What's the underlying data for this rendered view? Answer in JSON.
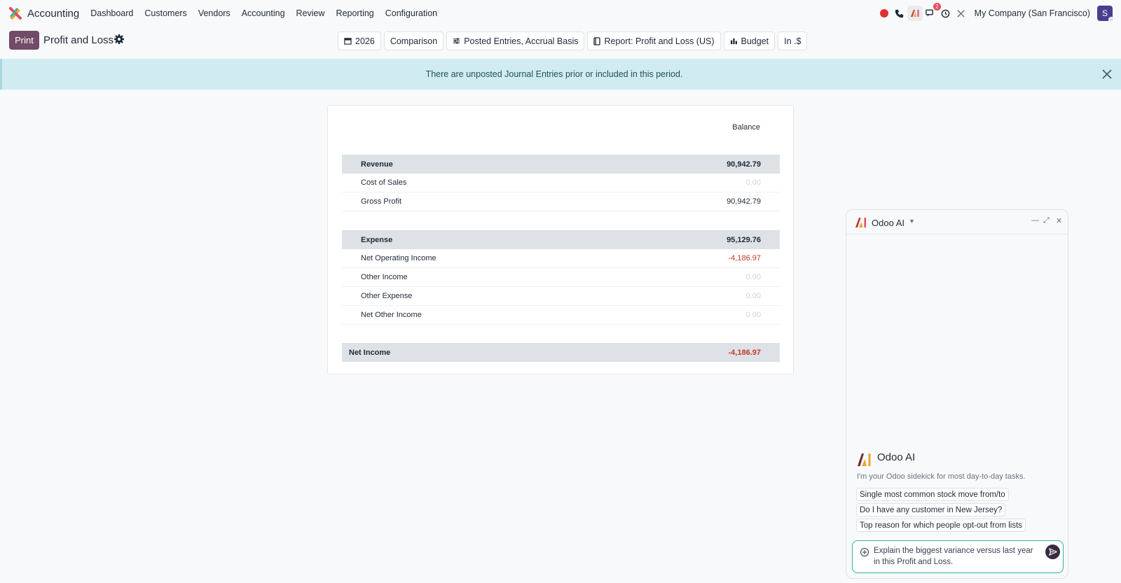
{
  "navbar": {
    "app_name": "Accounting",
    "menu": [
      "Dashboard",
      "Customers",
      "Vendors",
      "Accounting",
      "Review",
      "Reporting",
      "Configuration"
    ],
    "message_badge": "2",
    "company": "My Company (San Francisco)",
    "avatar_initial": "S"
  },
  "control_panel": {
    "print_label": "Print",
    "title": "Profit and Loss",
    "filters": {
      "period": "2026",
      "comparison": "Comparison",
      "entries": "Posted Entries, Accrual Basis",
      "report": "Report: Profit and Loss (US)",
      "budget": "Budget",
      "currency": "In .$"
    }
  },
  "alert": {
    "message": "There are unposted Journal Entries prior or included in this period."
  },
  "report": {
    "column_header": "Balance",
    "rows": [
      {
        "label": "Revenue",
        "value": "90,942.79"
      },
      {
        "label": "Cost of Sales",
        "value": "0.00"
      },
      {
        "label": "Gross Profit",
        "value": "90,942.79"
      },
      {
        "label": "Expense",
        "value": "95,129.76"
      },
      {
        "label": "Net Operating Income",
        "value": "-4,186.97"
      },
      {
        "label": "Other Income",
        "value": "0.00"
      },
      {
        "label": "Other Expense",
        "value": "0.00"
      },
      {
        "label": "Net Other Income",
        "value": "0.00"
      },
      {
        "label": "Net Income",
        "value": "-4,186.97"
      }
    ]
  },
  "ai_panel": {
    "title": "Odoo AI",
    "intro_title": "Odoo AI",
    "intro_subtitle": "I'm your Odoo sidekick for most day-to-day tasks.",
    "suggestions": [
      "Single most common stock move from/to",
      "Do I have any customer in New Jersey?",
      "Top reason for which people opt-out from lists"
    ],
    "composer_value": "Explain the biggest variance versus last year in this Profit and Loss."
  },
  "colors": {
    "brand": "#714b67",
    "negative": "#c0392b",
    "alert_bg": "#d1ecf1",
    "composer_border": "#2fb5a3"
  }
}
